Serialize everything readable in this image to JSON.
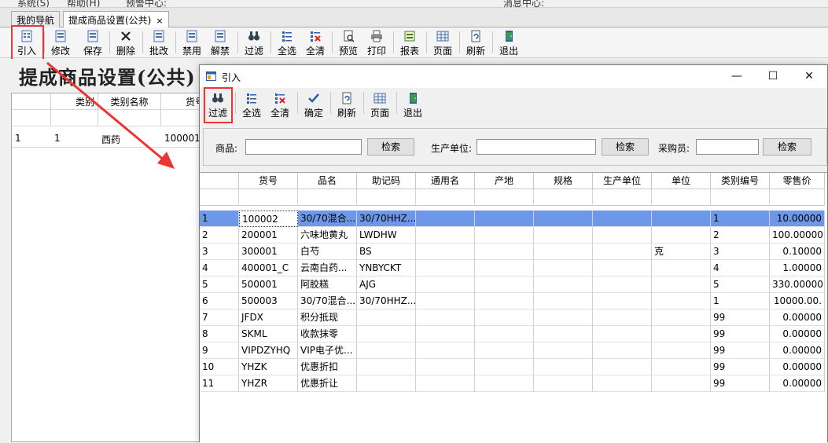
{
  "menubar": {
    "items": [
      "系统(S)",
      "帮助(H)",
      "预警中心:",
      "消息中心:"
    ]
  },
  "tabs": [
    {
      "label": "我的导航"
    },
    {
      "label": "提成商品设置(公共)",
      "close": "×"
    }
  ],
  "toolbar": {
    "items": [
      "引入",
      "修改",
      "保存",
      "删除",
      "批改",
      "禁用",
      "解禁",
      "过滤",
      "全选",
      "全清",
      "预览",
      "打印",
      "报表",
      "页面",
      "刷新",
      "退出"
    ]
  },
  "page": {
    "title": "提成商品设置(公共)"
  },
  "bg_grid": {
    "headers": [
      "类别",
      "类别名称",
      "货号"
    ],
    "rows": [
      [
        "1",
        "1",
        "西药",
        "100001"
      ]
    ],
    "right_header_fragment": "价",
    "right_cell_fragment": "0"
  },
  "dialog": {
    "title": "引入",
    "window_buttons": {
      "min": "—",
      "max": "☐",
      "close": "✕"
    },
    "toolbar": {
      "items": [
        "过滤",
        "全选",
        "全清",
        "确定",
        "刷新",
        "页面",
        "退出"
      ]
    },
    "filters": {
      "product_label": "商品:",
      "product_value": "",
      "search1": "检索",
      "producer_label": "生产单位:",
      "producer_value": "",
      "search2": "检索",
      "buyer_label": "采购员:",
      "buyer_value": "",
      "search3": "检索"
    },
    "columns": [
      "货号",
      "品名",
      "助记码",
      "通用名",
      "产地",
      "规格",
      "生产单位",
      "单位",
      "类别编号",
      "零售价"
    ],
    "rows": [
      {
        "n": "1",
        "code": "100002",
        "name": "30/70混合...",
        "mnem": "30/70HHZ...",
        "generic": "",
        "origin": "",
        "spec": "",
        "producer": "",
        "unit": "",
        "cat": "1",
        "price": "10.00000",
        "selected": true
      },
      {
        "n": "2",
        "code": "200001",
        "name": "六味地黄丸",
        "mnem": "LWDHW",
        "generic": "",
        "origin": "",
        "spec": "",
        "producer": "",
        "unit": "",
        "cat": "2",
        "price": "100.00000"
      },
      {
        "n": "3",
        "code": "300001",
        "name": "白芍",
        "mnem": "BS",
        "generic": "",
        "origin": "",
        "spec": "",
        "producer": "",
        "unit": "克",
        "cat": "3",
        "price": "0.10000"
      },
      {
        "n": "4",
        "code": "400001_C",
        "name": "云南白药...",
        "mnem": "YNBYCKT",
        "generic": "",
        "origin": "",
        "spec": "",
        "producer": "",
        "unit": "",
        "cat": "4",
        "price": "1.00000"
      },
      {
        "n": "5",
        "code": "500001",
        "name": "阿胶糕",
        "mnem": "AJG",
        "generic": "",
        "origin": "",
        "spec": "",
        "producer": "",
        "unit": "",
        "cat": "5",
        "price": "330.00000"
      },
      {
        "n": "6",
        "code": "500003",
        "name": "30/70混合...",
        "mnem": "30/70HHZ...",
        "generic": "",
        "origin": "",
        "spec": "",
        "producer": "",
        "unit": "",
        "cat": "1",
        "price": "10000.00."
      },
      {
        "n": "7",
        "code": "JFDX",
        "name": "积分抵现",
        "mnem": "",
        "generic": "",
        "origin": "",
        "spec": "",
        "producer": "",
        "unit": "",
        "cat": "99",
        "price": "0.00000"
      },
      {
        "n": "8",
        "code": "SKML",
        "name": "收款抹零",
        "mnem": "",
        "generic": "",
        "origin": "",
        "spec": "",
        "producer": "",
        "unit": "",
        "cat": "99",
        "price": "0.00000"
      },
      {
        "n": "9",
        "code": "VIPDZYHQ",
        "name": "VIP电子优...",
        "mnem": "",
        "generic": "",
        "origin": "",
        "spec": "",
        "producer": "",
        "unit": "",
        "cat": "99",
        "price": "0.00000"
      },
      {
        "n": "10",
        "code": "YHZK",
        "name": "优惠折扣",
        "mnem": "",
        "generic": "",
        "origin": "",
        "spec": "",
        "producer": "",
        "unit": "",
        "cat": "99",
        "price": "0.00000"
      },
      {
        "n": "11",
        "code": "YHZR",
        "name": "优惠折让",
        "mnem": "",
        "generic": "",
        "origin": "",
        "spec": "",
        "producer": "",
        "unit": "",
        "cat": "99",
        "price": "0.00000"
      }
    ]
  },
  "colors": {
    "highlight": "#e33333",
    "selection": "#6d97e8"
  }
}
